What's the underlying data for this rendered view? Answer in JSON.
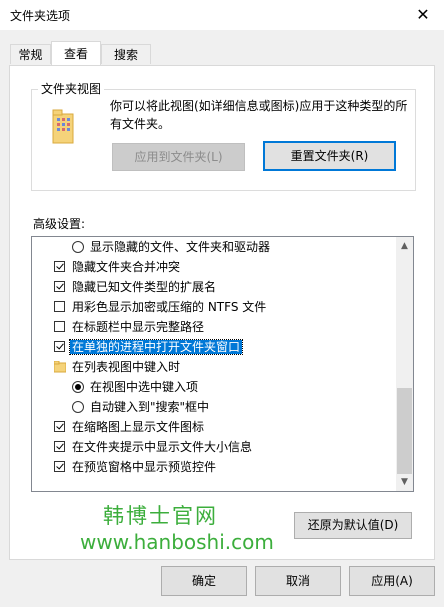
{
  "window": {
    "title": "文件夹选项",
    "close_icon": "close-icon"
  },
  "tabs": [
    {
      "label": "常规",
      "active": false
    },
    {
      "label": "查看",
      "active": true
    },
    {
      "label": "搜索",
      "active": false
    }
  ],
  "folder_view": {
    "group_label": "文件夹视图",
    "description_line1": "你可以将此视图(如详细信息或图标)应用于这种类型的所",
    "description_line2": "有文件夹。",
    "apply_button": "应用到文件夹(L)",
    "reset_button": "重置文件夹(R)"
  },
  "advanced": {
    "label": "高级设置:",
    "items": [
      {
        "type": "radio",
        "label": "显示隐藏的文件、文件夹和驱动器",
        "checked": false,
        "indent": 2
      },
      {
        "type": "checkbox",
        "label": "隐藏文件夹合并冲突",
        "checked": true,
        "indent": 1
      },
      {
        "type": "checkbox",
        "label": "隐藏已知文件类型的扩展名",
        "checked": true,
        "indent": 1
      },
      {
        "type": "checkbox",
        "label": "用彩色显示加密或压缩的 NTFS 文件",
        "checked": false,
        "indent": 1
      },
      {
        "type": "checkbox",
        "label": "在标题栏中显示完整路径",
        "checked": false,
        "indent": 1
      },
      {
        "type": "checkbox",
        "label": "在单独的进程中打开文件夹窗口",
        "checked": true,
        "indent": 1,
        "selected": true
      },
      {
        "type": "folder",
        "label": "在列表视图中键入时",
        "indent": 1
      },
      {
        "type": "radio",
        "label": "在视图中选中键入项",
        "checked": true,
        "indent": 2
      },
      {
        "type": "radio",
        "label": "自动键入到\"搜索\"框中",
        "checked": false,
        "indent": 2
      },
      {
        "type": "checkbox",
        "label": "在缩略图上显示文件图标",
        "checked": true,
        "indent": 1
      },
      {
        "type": "checkbox",
        "label": "在文件夹提示中显示文件大小信息",
        "checked": true,
        "indent": 1
      },
      {
        "type": "checkbox",
        "label": "在预览窗格中显示预览控件",
        "checked": true,
        "indent": 1
      }
    ],
    "restore_button": "还原为默认值(D)"
  },
  "watermark": {
    "line1": "韩博士官网",
    "line2": "www.hanboshi.com"
  },
  "footer": {
    "ok": "确定",
    "cancel": "取消",
    "apply": "应用(A)"
  }
}
